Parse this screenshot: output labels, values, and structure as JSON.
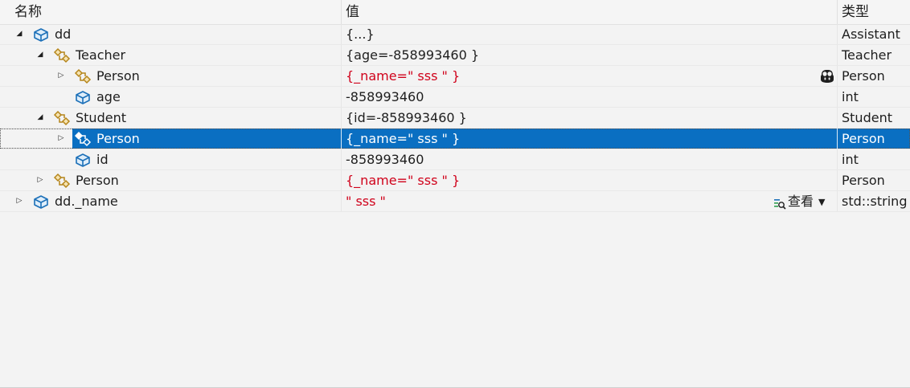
{
  "header": {
    "name_col": "名称",
    "value_col": "值",
    "type_col": "类型"
  },
  "rows": [
    {
      "name": "dd",
      "value": "{...}",
      "type": "Assistant",
      "expand": "expanded",
      "icon": "variable-cube-icon",
      "level": 0
    },
    {
      "name": "Teacher",
      "value": "{age=-858993460 }",
      "type": "Teacher",
      "expand": "expanded",
      "icon": "base-class-icon",
      "level": 1
    },
    {
      "name": "Person",
      "value": "{_name=\" sss \" }",
      "type": "Person",
      "expand": "collapsed",
      "icon": "base-class-icon",
      "level": 2,
      "value_red": true
    },
    {
      "name": "age",
      "value": "-858993460",
      "type": "int",
      "expand": "none",
      "icon": "field-cube-icon",
      "level": 2
    },
    {
      "name": "Student",
      "value": "{id=-858993460 }",
      "type": "Student",
      "expand": "expanded",
      "icon": "base-class-icon",
      "level": 1
    },
    {
      "name": "Person",
      "value": "{_name=\" sss \" }",
      "type": "Person",
      "expand": "collapsed",
      "icon": "base-class-icon",
      "level": 2,
      "selected": true
    },
    {
      "name": "id",
      "value": "-858993460",
      "type": "int",
      "expand": "none",
      "icon": "field-cube-icon",
      "level": 2
    },
    {
      "name": "Person",
      "value": "{_name=\" sss \" }",
      "type": "Person",
      "expand": "collapsed",
      "icon": "base-class-icon",
      "level": 1,
      "value_red": true
    },
    {
      "name": "dd._name",
      "value": "\" sss \"",
      "type": "std::string",
      "expand": "collapsed",
      "icon": "variable-cube-icon",
      "level": 0,
      "value_red": true
    }
  ],
  "view_button": {
    "label": "查看",
    "icon": "magnifier-visualizer-icon"
  },
  "copilot_icon": "copilot-icon",
  "colors": {
    "selection": "#0a6fc2",
    "changed_value": "#d0021b",
    "background": "#f3f3f3"
  }
}
